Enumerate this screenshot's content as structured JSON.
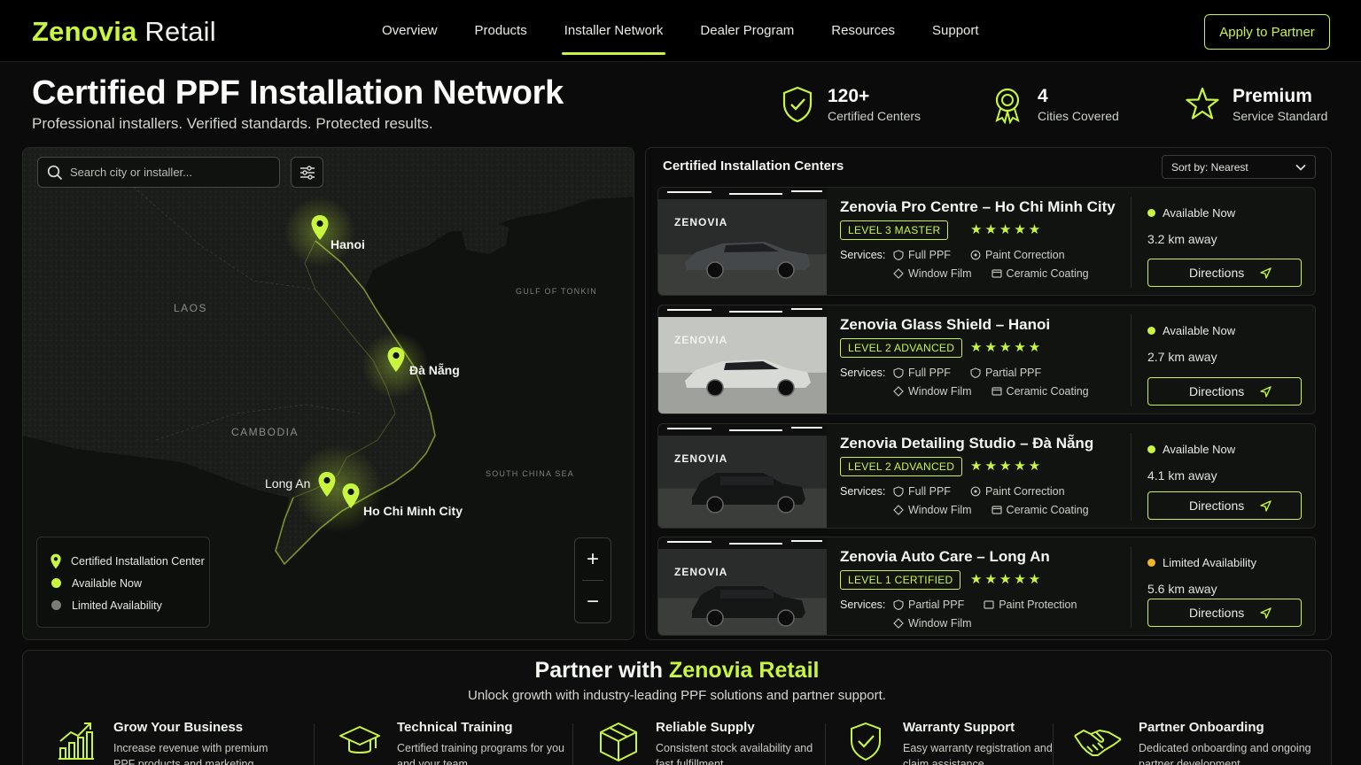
{
  "header": {
    "brand_a": "Zenovia",
    "brand_b": "Retail",
    "nav": [
      "Overview",
      "Products",
      "Installer Network",
      "Dealer Program",
      "Resources",
      "Support"
    ],
    "active_nav": "Installer Network",
    "cta": "Apply to Partner"
  },
  "hero": {
    "title": "Certified PPF Installation Network",
    "subtitle": "Professional installers. Verified standards. Protected results.",
    "stats": [
      {
        "value": "120+",
        "label": "Certified Centers",
        "icon": "shield-check-icon"
      },
      {
        "value": "4",
        "label": "Cities Covered",
        "icon": "award-ribbon-icon"
      },
      {
        "value": "Premium",
        "label": "Service Standard",
        "icon": "star-outline-icon"
      }
    ]
  },
  "map": {
    "search_placeholder": "Search city or installer...",
    "regions": [
      "LAOS",
      "CAMBODIA"
    ],
    "seas": [
      "GULF OF TONKIN",
      "SOUTH CHINA SEA"
    ],
    "cities": [
      "Hanoi",
      "Đà Nẵng",
      "Long An",
      "Ho Chi Minh City"
    ],
    "legend": {
      "center": "Certified Installation Center",
      "available": "Available Now",
      "limited": "Limited Availability"
    },
    "zoom_in": "+",
    "zoom_out": "−"
  },
  "list": {
    "title": "Certified Installation Centers",
    "sort": "Sort by: Nearest",
    "services_label": "Services:",
    "directions": "Directions",
    "centers": [
      {
        "name": "Zenovia Pro Centre – Ho Chi Minh City",
        "level": "LEVEL 3 MASTER",
        "rating": 5,
        "services": [
          "Full PPF",
          "Paint Correction",
          "Window Film",
          "Ceramic Coating"
        ],
        "status": "Available Now",
        "distance": "3.2 km away",
        "wall_text": "ZENOVIA",
        "car": "coupe-grey"
      },
      {
        "name": "Zenovia Glass Shield – Hanoi",
        "level": "LEVEL 2 ADVANCED",
        "rating": 5,
        "services": [
          "Full PPF",
          "Partial PPF",
          "Window Film",
          "Ceramic Coating"
        ],
        "status": "Available Now",
        "distance": "2.7 km away",
        "wall_text": "ZENOVIA",
        "car": "sedan-white"
      },
      {
        "name": "Zenovia Detailing Studio – Đà Nẵng",
        "level": "LEVEL 2 ADVANCED",
        "rating": 5,
        "services": [
          "Full PPF",
          "Paint Correction",
          "Window Film",
          "Ceramic Coating"
        ],
        "status": "Available Now",
        "distance": "4.1 km away",
        "wall_text": "ZENOVIA",
        "car": "suv-black"
      },
      {
        "name": "Zenovia Auto Care – Long An",
        "level": "LEVEL 1 CERTIFIED",
        "rating": 5,
        "services": [
          "Partial PPF",
          "Paint Protection",
          "Window Film"
        ],
        "status": "Limited Availability",
        "distance": "5.6 km away",
        "wall_text": "ZENOVIA",
        "car": "suv-black"
      }
    ]
  },
  "partner": {
    "title_a": "Partner with",
    "title_b": "Zenovia Retail",
    "subtitle": "Unlock growth with industry-leading PPF solutions and partner support.",
    "features": [
      {
        "title": "Grow Your Business",
        "desc": "Increase revenue with premium PPF products and marketing support",
        "icon": "growth-chart-icon"
      },
      {
        "title": "Technical Training",
        "desc": "Certified training programs for you and your team",
        "icon": "graduation-cap-icon"
      },
      {
        "title": "Reliable Supply",
        "desc": "Consistent stock availability and fast fulfillment",
        "icon": "box-icon"
      },
      {
        "title": "Warranty Support",
        "desc": "Easy warranty registration and claim assistance",
        "icon": "shield-check-icon"
      },
      {
        "title": "Partner Onboarding",
        "desc": "Dedicated onboarding and ongoing partner development",
        "icon": "handshake-icon"
      }
    ]
  },
  "colors": {
    "accent": "#c8f53f",
    "limited": "#f0b429",
    "background": "#0a0b0a"
  }
}
